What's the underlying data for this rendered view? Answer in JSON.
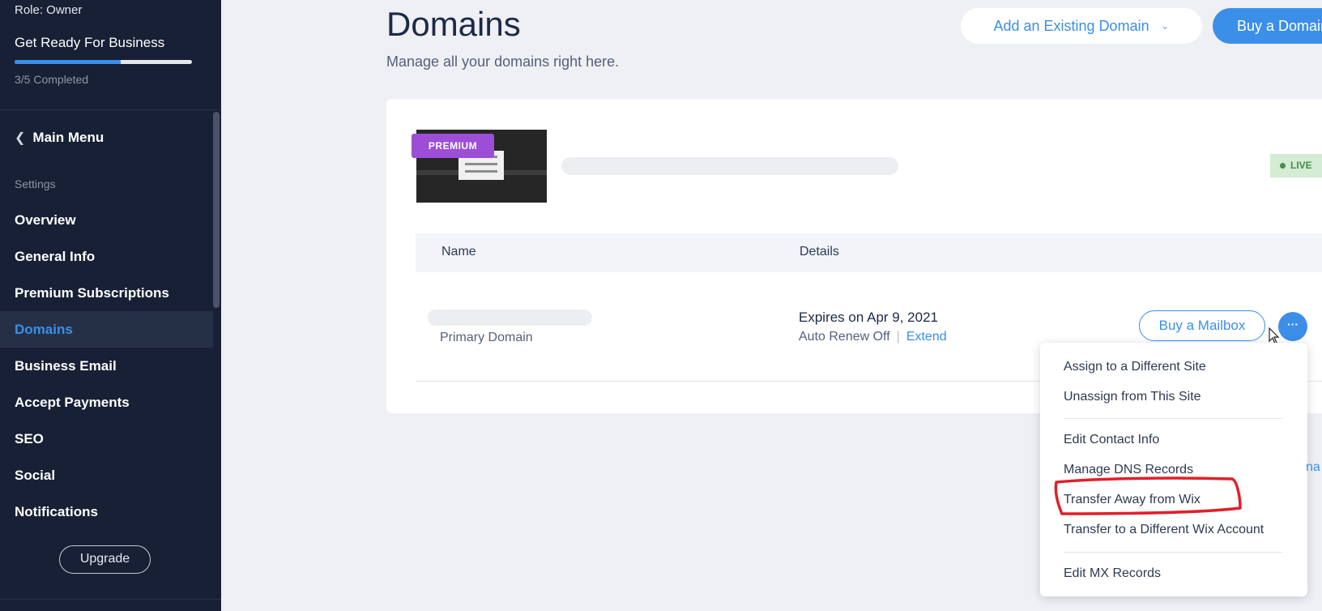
{
  "sidebar": {
    "role": "Role: Owner",
    "checklist_title": "Get Ready For Business",
    "progress_fraction": 0.6,
    "progress_text": "3/5 Completed",
    "main_menu": "Main Menu",
    "section_label": "Settings",
    "items": [
      {
        "label": "Overview"
      },
      {
        "label": "General Info"
      },
      {
        "label": "Premium Subscriptions"
      },
      {
        "label": "Domains"
      },
      {
        "label": "Business Email"
      },
      {
        "label": "Accept Payments"
      },
      {
        "label": "SEO"
      },
      {
        "label": "Social"
      },
      {
        "label": "Notifications"
      }
    ],
    "active_item": "Domains",
    "upgrade": "Upgrade"
  },
  "header": {
    "title": "Domains",
    "subtitle": "Manage all your domains right here.",
    "add_domain": "Add an Existing Domain",
    "buy_domain": "Buy a Domain"
  },
  "site": {
    "badge": "PREMIUM",
    "status": "LIVE"
  },
  "table": {
    "columns": [
      "Name",
      "Details"
    ],
    "row": {
      "type": "Primary Domain",
      "expires": "Expires on Apr 9, 2021",
      "auto_renew": "Auto Renew Off",
      "separator": "|",
      "extend": "Extend",
      "mailbox_button": "Buy a Mailbox",
      "more_button": "···"
    }
  },
  "dropdown": {
    "items": [
      "Assign to a Different Site",
      "Unassign from This Site",
      "Edit Contact Info",
      "Manage DNS Records",
      "Transfer Away from Wix",
      "Transfer to a Different Wix Account",
      "Edit MX Records"
    ],
    "highlighted": "Transfer Away from Wix"
  },
  "edge_text": "na",
  "colors": {
    "sidebar_bg": "#172034",
    "accent": "#3b8fe8",
    "premium": "#9c4fd6",
    "live": "#4a8a4a",
    "annotation": "#e0202a"
  }
}
